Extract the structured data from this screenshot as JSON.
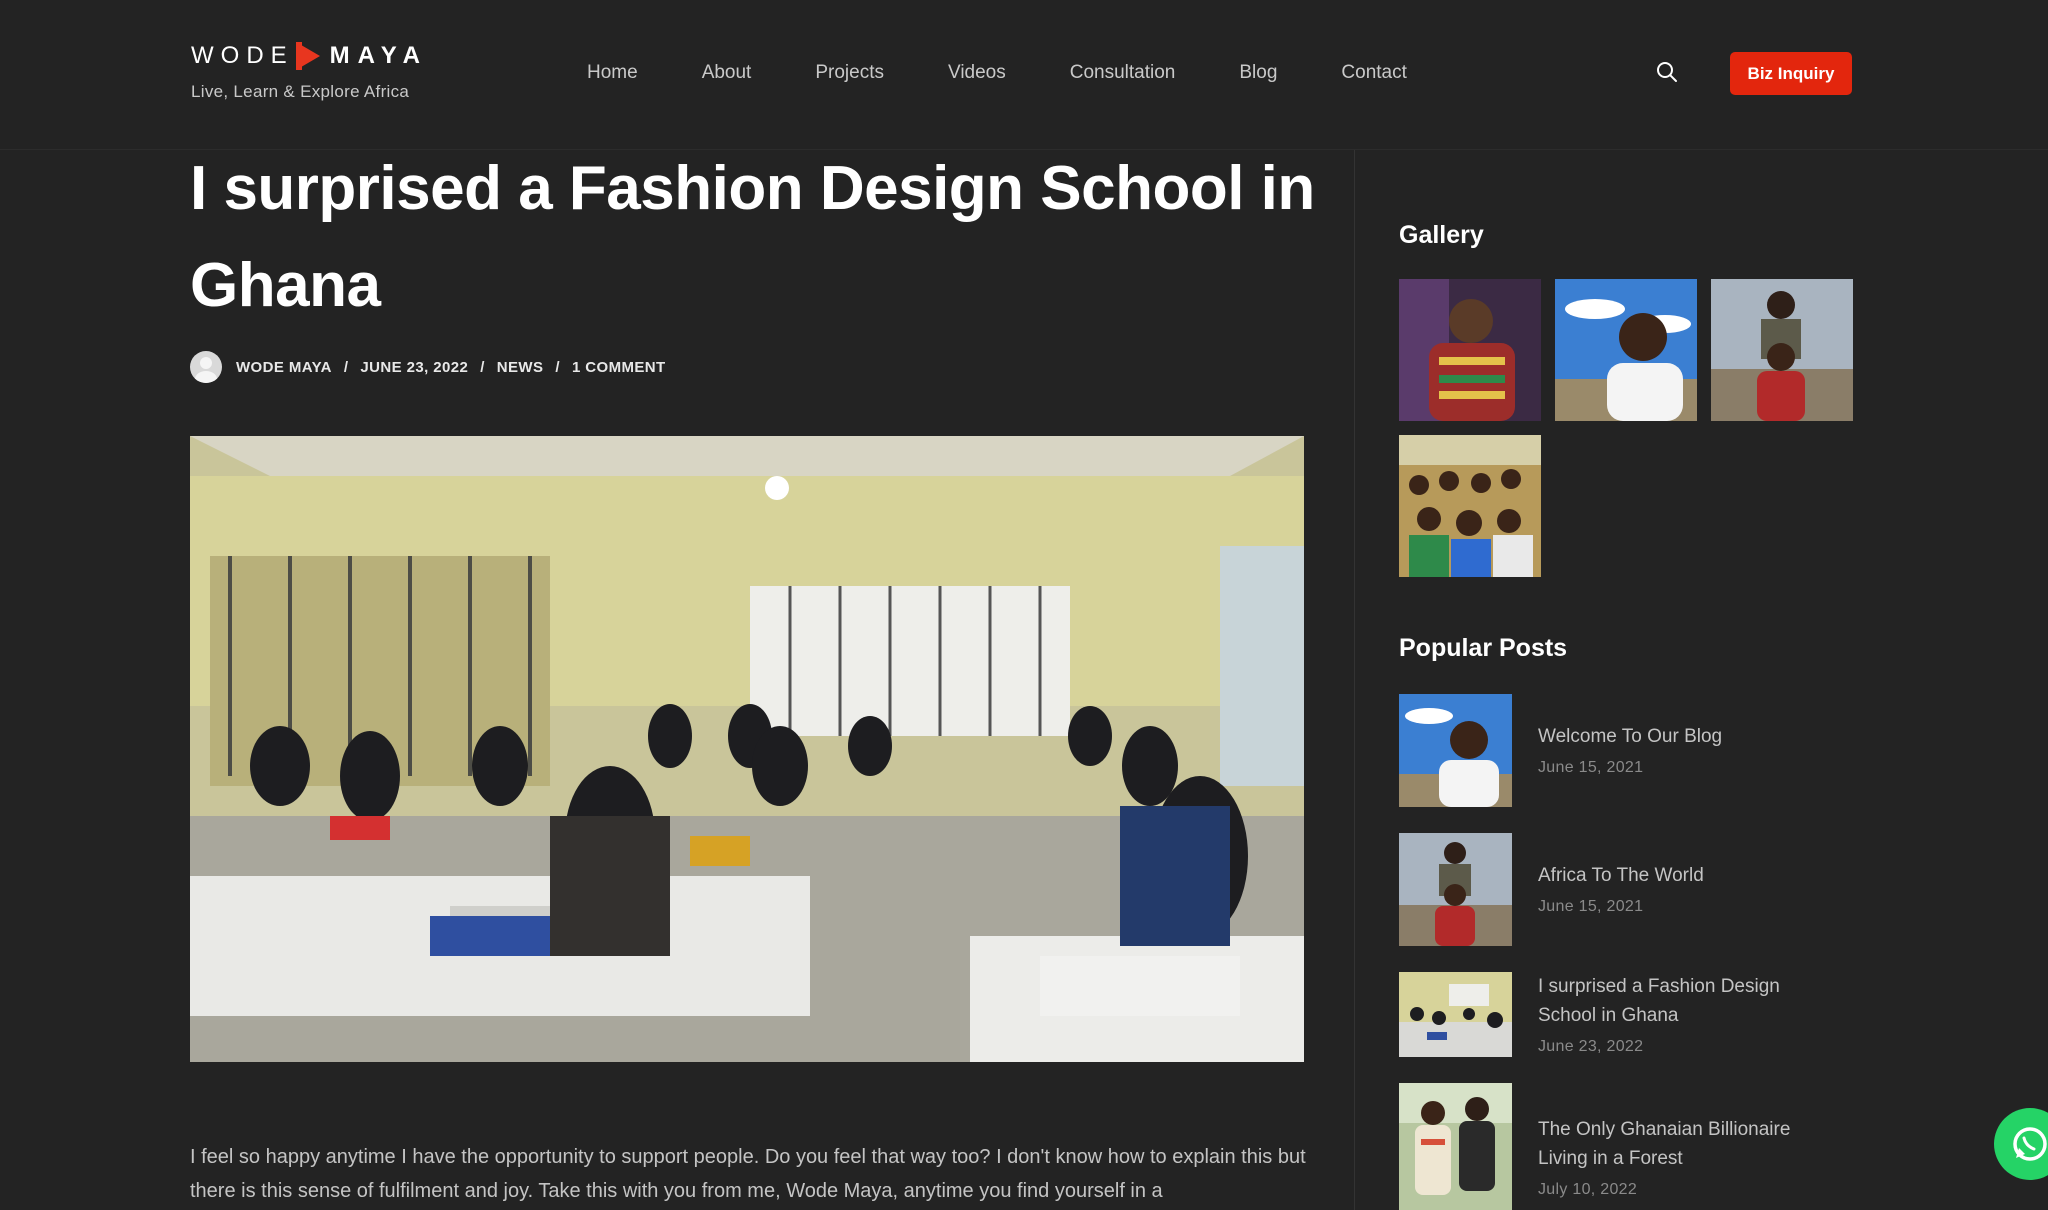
{
  "header": {
    "logo_left": "WODE",
    "logo_right": "MAYA",
    "tagline": "Live, Learn & Explore Africa",
    "nav": [
      "Home",
      "About",
      "Projects",
      "Videos",
      "Consultation",
      "Blog",
      "Contact"
    ],
    "cta": "Biz Inquiry",
    "accent_color": "#e3260d"
  },
  "article": {
    "title": "I surprised a Fashion Design School in Ghana",
    "author": "WODE MAYA",
    "date": "JUNE 23, 2022",
    "category": "NEWS",
    "comments": "1 COMMENT",
    "separator": "/",
    "body": "I feel so happy anytime I have the opportunity to support people. Do you feel that way too? I don't know how to explain this but there is this sense of fulfilment and joy. Take this with you from me, Wode Maya, anytime you find yourself in a"
  },
  "sidebar": {
    "gallery_title": "Gallery",
    "popular_title": "Popular Posts",
    "popular_posts": [
      {
        "title": "Welcome To Our Blog",
        "date": "June 15, 2021"
      },
      {
        "title": "Africa To The World",
        "date": "June 15, 2021"
      },
      {
        "title": "I surprised a Fashion Design School in Ghana",
        "date": "June 23, 2022"
      },
      {
        "title": "The Only Ghanaian Billionaire Living in a Forest",
        "date": "July 10, 2022"
      }
    ]
  },
  "icons": {
    "search": "search-icon",
    "whatsapp": "whatsapp-icon"
  }
}
